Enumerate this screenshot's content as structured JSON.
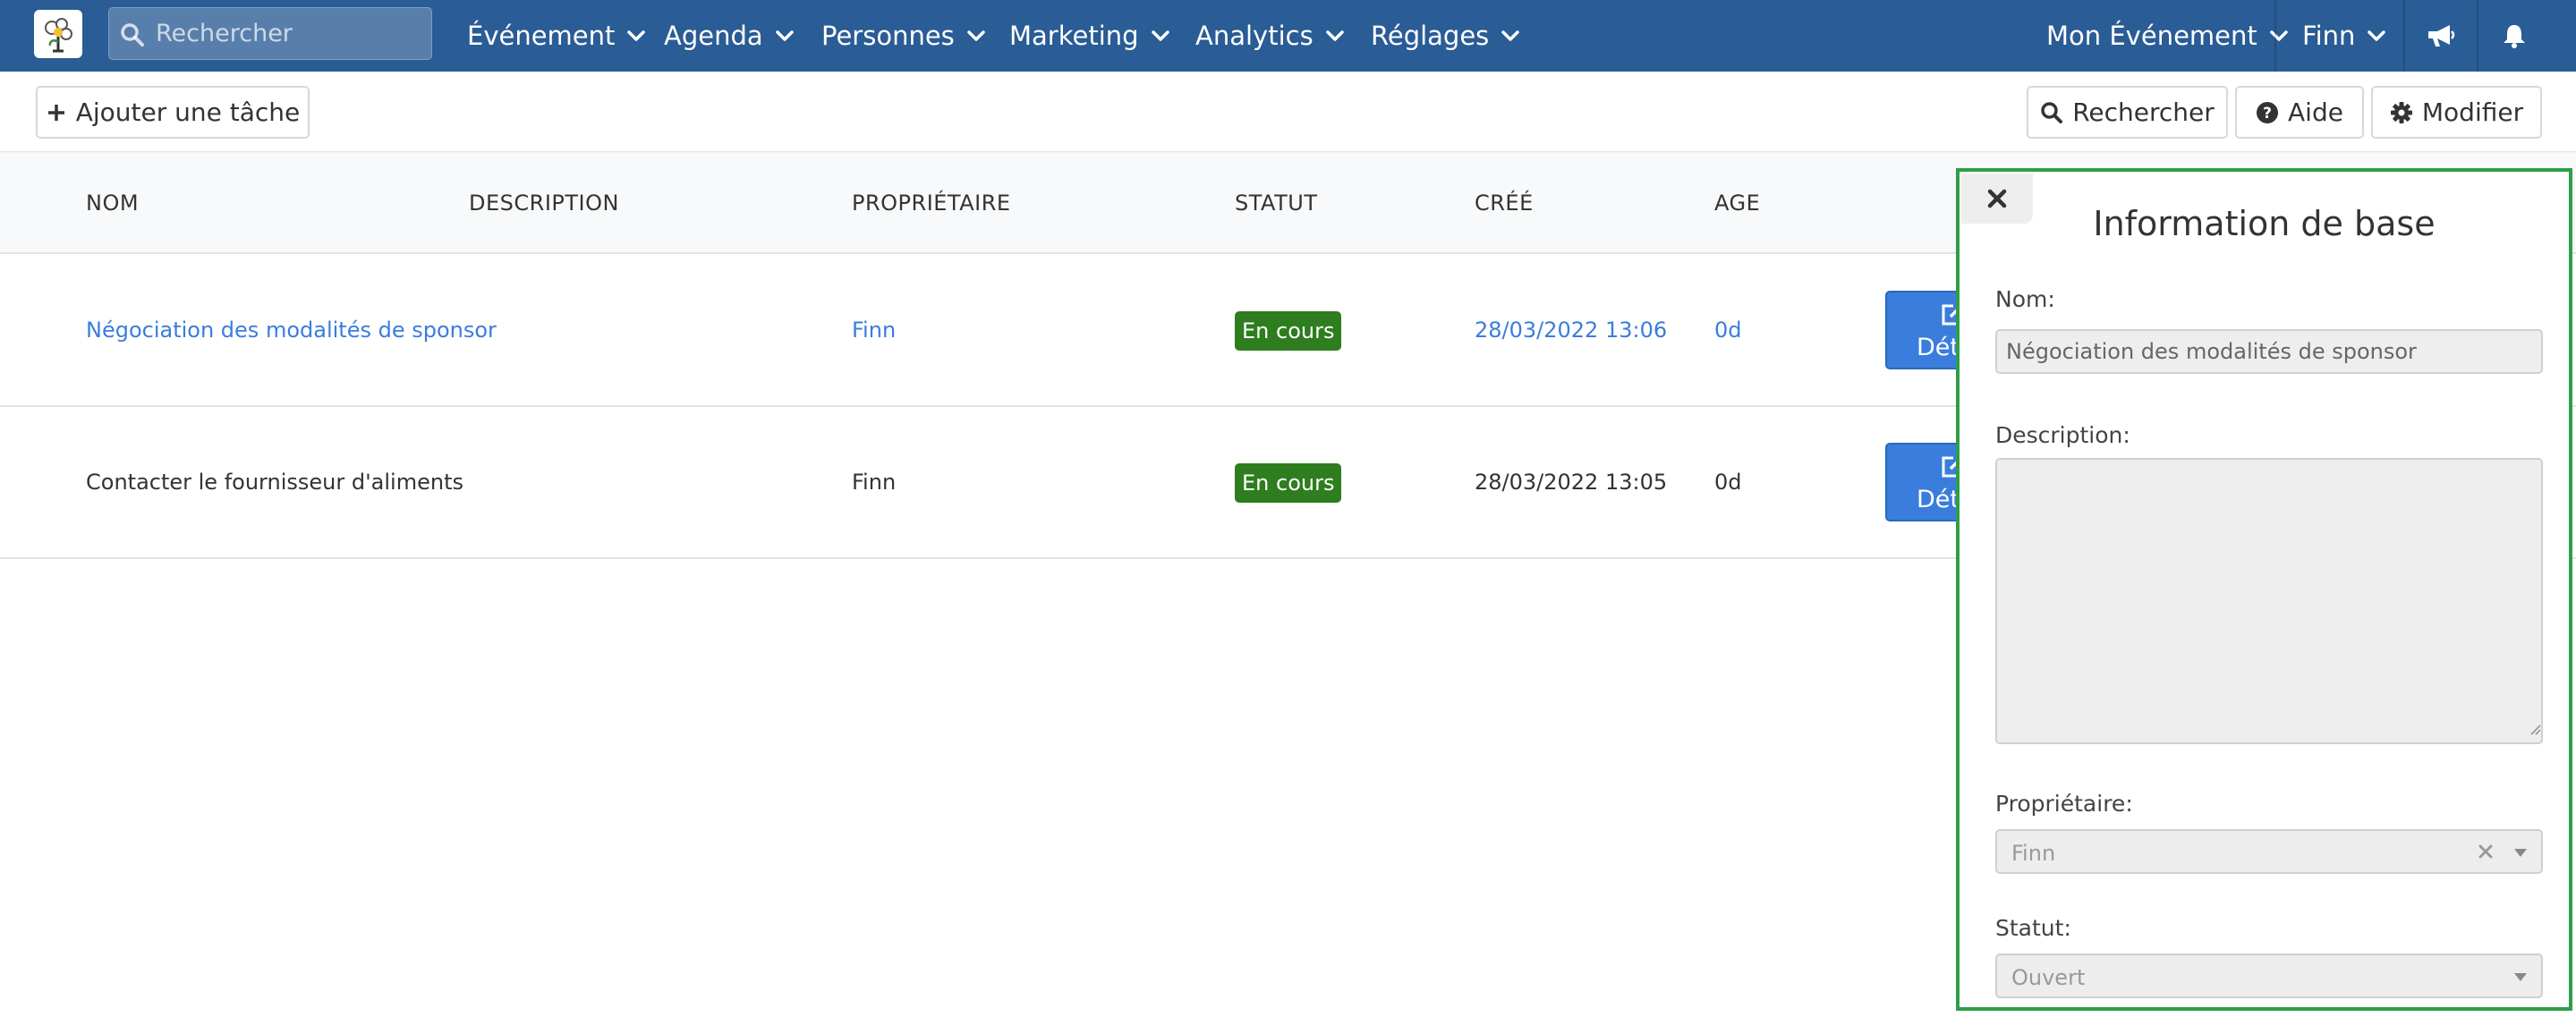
{
  "navbar": {
    "search_placeholder": "Rechercher",
    "menu": [
      "Événement",
      "Agenda",
      "Personnes",
      "Marketing",
      "Analytics",
      "Réglages"
    ],
    "event_selector": "Mon Événement",
    "user": "Finn",
    "icons": [
      "megaphone-icon",
      "bell-icon"
    ],
    "color": "#2a5c95"
  },
  "toolbar": {
    "add_task_label": "Ajouter une tâche",
    "search_label": "Rechercher",
    "help_label": "Aide",
    "edit_label": "Modifier"
  },
  "table": {
    "headers": [
      "NOM",
      "DESCRIPTION",
      "PROPRIÉTAIRE",
      "STATUT",
      "CRÉÉ",
      "AGE"
    ],
    "rows": [
      {
        "name": "Négociation des modalités de sponsor",
        "description": "",
        "owner": "Finn",
        "status": "En cours",
        "created": "28/03/2022 13:06",
        "age": "0d",
        "action": "Détails"
      },
      {
        "name": "Contacter le fournisseur d'aliments",
        "description": "",
        "owner": "Finn",
        "status": "En cours",
        "created": "28/03/2022 13:05",
        "age": "0d",
        "action": "Détails"
      }
    ],
    "status_color": "#2e7d1e",
    "link_color": "#3b7ddd"
  },
  "panel": {
    "title": "Information de base",
    "name_label": "Nom:",
    "name_value": "Négociation des modalités de sponsor",
    "description_label": "Description:",
    "description_value": "",
    "owner_label": "Propriétaire:",
    "owner_value": "Finn",
    "status_label": "Statut:",
    "status_value": "Ouvert",
    "border_color": "#2e9e48"
  }
}
